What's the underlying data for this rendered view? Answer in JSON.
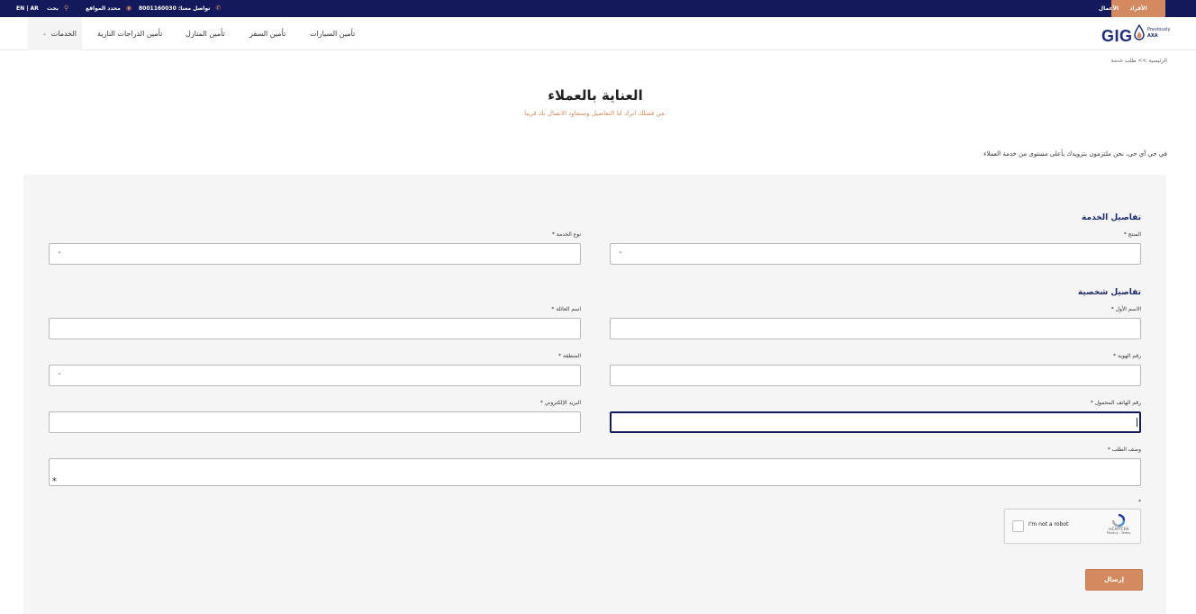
{
  "topbar": {
    "individuals": "الأفراد",
    "business": "الأعمال",
    "contact": "تواصل معنا: 8001160030",
    "locator": "محدد المواقع",
    "search": "بحث",
    "lang": "EN | AR",
    "accent_color": "#d38a5f",
    "bar_color": "#13195a"
  },
  "logo": {
    "brand": "GIG",
    "previously": "Previously",
    "previous_brand": "AXA",
    "brand_color": "#1d2d79"
  },
  "nav": {
    "cars": "تأمين السيارات",
    "travel": "تأمين السفر",
    "home": "تأمين المنازل",
    "moto": "تأمين الدراجات النارية",
    "services": "الخدمات"
  },
  "breadcrumb": "الرئيسية >> طلب خدمة",
  "header": {
    "title": "العناية بالعملاء",
    "subtitle": "من فضلك اترك لنا التفاصيل وسنعاود الاتصال بك قريبا."
  },
  "intro": "في جي آي جي، نحن ملتزمون بتزويدك بأعلى مستوى من خدمة العملاء",
  "form": {
    "service_section": "تفاصيل الخدمة",
    "product_label": "المنتج *",
    "service_type_label": "نوع الخدمة *",
    "personal_section": "تفاصيل شخصية",
    "first_name_label": "الاسم الأول *",
    "family_name_label": "اسم العائلة *",
    "id_number_label": "رقم الهوية *",
    "region_label": "المنطقة *",
    "mobile_label": "رقم الهاتف المحمول *",
    "email_label": "البريد الإلكتروني *",
    "description_label": "وصف الطلب *",
    "required_mark": "*",
    "submit_label": "إرسال"
  },
  "recaptcha": {
    "label": "I'm not a robot",
    "brand": "reCAPTCHA",
    "terms": "Privacy - Terms"
  }
}
